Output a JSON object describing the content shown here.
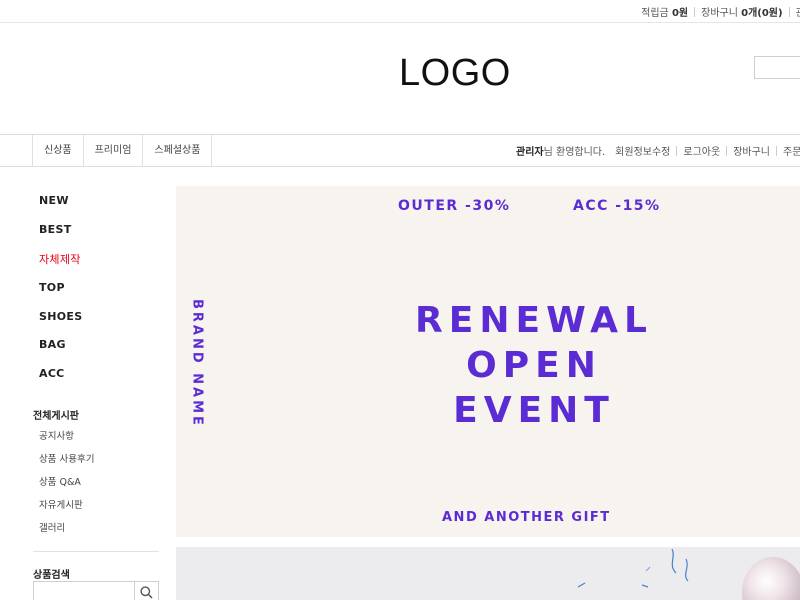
{
  "topbar": {
    "points_label": "적립금",
    "points_value": "0원",
    "cart_label": "장바구니",
    "cart_value": "0개(0원)",
    "wish_label": "관심"
  },
  "header": {
    "logo": "LOGO",
    "search_placeholder": ""
  },
  "nav": {
    "categories": [
      "신상품",
      "프리미엄",
      "스페셜상품"
    ],
    "member_name": "관리자",
    "member_greeting": "님 환영합니다.",
    "member_links": [
      "회원정보수정",
      "로그아웃",
      "장바구니",
      "주문조회"
    ]
  },
  "sidebar": {
    "categories": [
      "NEW",
      "BEST",
      "자체제작",
      "TOP",
      "SHOES",
      "BAG",
      "ACC"
    ],
    "highlight_color": "#e60012",
    "board_title": "전체게시판",
    "boards": [
      "공지사항",
      "상품 사용후기",
      "상품 Q&A",
      "자유게시판",
      "갤러리"
    ],
    "search_title": "상품검색",
    "search_placeholder": ""
  },
  "banner": {
    "promo_outer": "OUTER -30%",
    "promo_acc": "ACC -15%",
    "brand": "BRAND NAME",
    "headline": [
      "RENEWAL",
      "OPEN",
      "EVENT"
    ],
    "gift": "AND ANOTHER GIFT",
    "accent_color": "#5b2bd4",
    "background_color": "#f7f3ee"
  },
  "icons": {
    "search": "search-icon",
    "balloon": "balloon-icon"
  }
}
